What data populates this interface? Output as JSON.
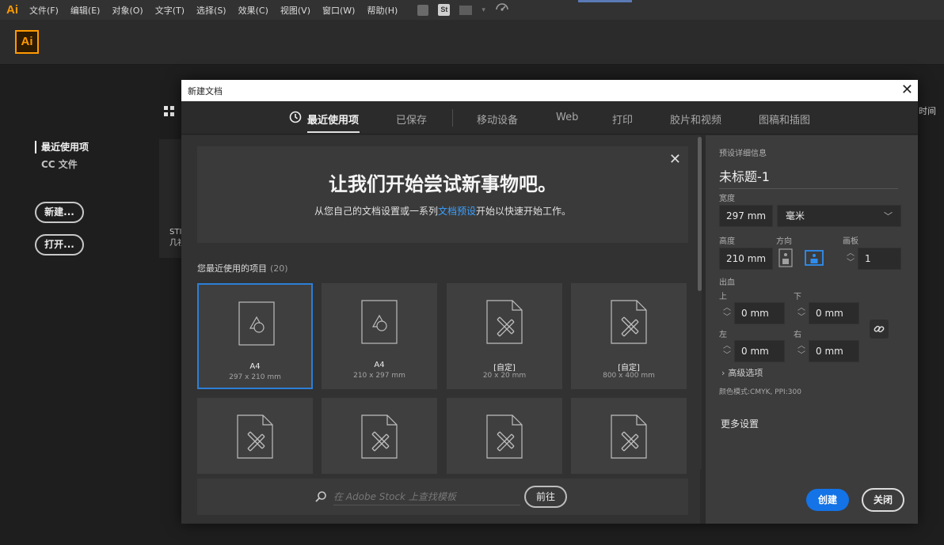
{
  "menubar": {
    "app_glyph": "Ai",
    "items": [
      "文件(F)",
      "编辑(E)",
      "对象(O)",
      "文字(T)",
      "选择(S)",
      "效果(C)",
      "视图(V)",
      "窗口(W)",
      "帮助(H)"
    ],
    "icons": [
      "bridge-icon",
      "stock-icon",
      "workspace-layout-icon",
      "sync-icon"
    ],
    "st_label": "St"
  },
  "app": {
    "logo": "Ai"
  },
  "home": {
    "nav": {
      "recent": "最近使用项",
      "cc_files": "CC 文件"
    },
    "new_button": "新建...",
    "open_button": "打开...",
    "stub_line1": "STI",
    "stub_line2": "几衫",
    "right_text": "时间"
  },
  "dialog": {
    "title": "新建文档",
    "tabs": [
      {
        "label": "最近使用项",
        "active": true
      },
      {
        "label": "已保存"
      },
      {
        "label": "移动设备"
      },
      {
        "label": "Web"
      },
      {
        "label": "打印"
      },
      {
        "label": "胶片和视频"
      },
      {
        "label": "图稿和插图"
      }
    ],
    "banner": {
      "title": "让我们开始尝试新事物吧。",
      "sub_pre": "从您自己的文档设置或一系列",
      "sub_link": "文档预设",
      "sub_post": "开始以快速开始工作。"
    },
    "recent": {
      "heading": "您最近使用的项目",
      "count": "(20)",
      "cards": [
        {
          "name": "A4",
          "size": "297 x 210 mm",
          "icon": "shapes-doc-icon",
          "selected": true
        },
        {
          "name": "A4",
          "size": "210 x 297 mm",
          "icon": "shapes-doc-icon"
        },
        {
          "name": "[自定]",
          "size": "20 x 20 mm",
          "icon": "pencil-ruler-doc-icon"
        },
        {
          "name": "[自定]",
          "size": "800 x 400 mm",
          "icon": "pencil-ruler-doc-icon"
        },
        {
          "icon": "pencil-ruler-doc-icon"
        },
        {
          "icon": "pencil-ruler-doc-icon"
        },
        {
          "icon": "pencil-ruler-doc-icon"
        },
        {
          "icon": "pencil-ruler-doc-icon"
        }
      ]
    },
    "search": {
      "placeholder": "在 Adobe Stock 上查找模板",
      "go": "前往"
    },
    "details": {
      "heading": "预设详细信息",
      "doc_name": "未标题-1",
      "width_label": "宽度",
      "width_value": "297 mm",
      "unit": "毫米",
      "height_label": "高度",
      "height_value": "210 mm",
      "orientation_label": "方向",
      "orientation": "landscape",
      "artboards_label": "画板",
      "artboards_value": "1",
      "bleed_label": "出血",
      "bleed_top_label": "上",
      "bleed_top": "0 mm",
      "bleed_bottom_label": "下",
      "bleed_bottom": "0 mm",
      "bleed_left_label": "左",
      "bleed_left": "0 mm",
      "bleed_right_label": "右",
      "bleed_right": "0 mm",
      "advanced": "高级选项",
      "color_mode": "颜色模式:CMYK, PPI:300",
      "more_settings": "更多设置",
      "create_button": "创建",
      "close_button": "关闭"
    }
  },
  "colors": {
    "accent": "#1473e6",
    "selection": "#2d7fd6",
    "brand": "#ff9a00",
    "link": "#3aa0ff"
  }
}
